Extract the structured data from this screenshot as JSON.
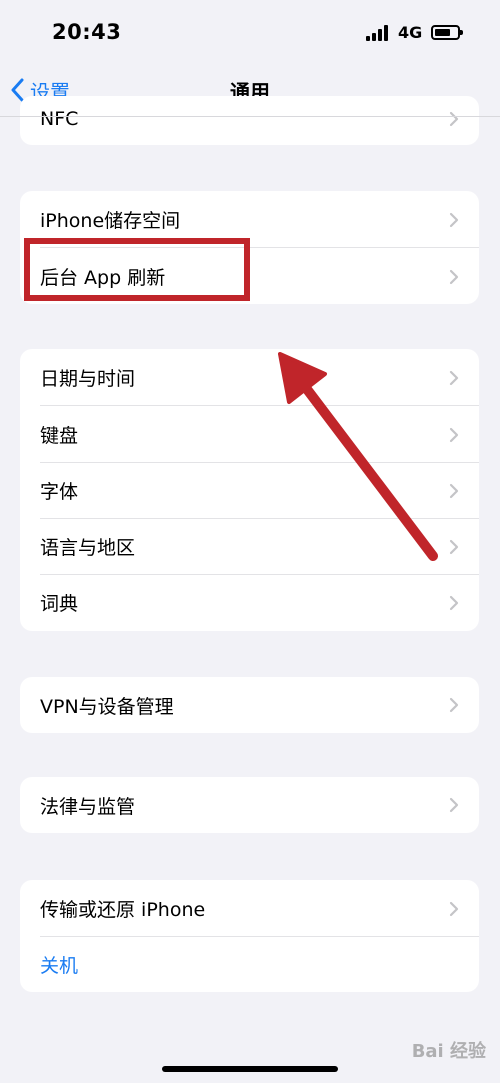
{
  "status_bar": {
    "time": "20:43",
    "network": "4G"
  },
  "navbar": {
    "back_label": "设置",
    "title": "通用"
  },
  "groups": [
    {
      "items": [
        {
          "label": "NFC"
        }
      ]
    },
    {
      "items": [
        {
          "label": "iPhone储存空间"
        },
        {
          "label": "后台 App 刷新"
        }
      ]
    },
    {
      "items": [
        {
          "label": "日期与时间"
        },
        {
          "label": "键盘"
        },
        {
          "label": "字体"
        },
        {
          "label": "语言与地区"
        },
        {
          "label": "词典"
        }
      ]
    },
    {
      "items": [
        {
          "label": "VPN与设备管理"
        }
      ]
    },
    {
      "items": [
        {
          "label": "法律与监管"
        }
      ]
    },
    {
      "items": [
        {
          "label": "传输或还原 iPhone"
        },
        {
          "label": "关机"
        }
      ]
    }
  ],
  "watermark": "Bai 经验",
  "colors": {
    "accent": "#1a7cf2",
    "annotation": "#c0252a",
    "background": "#f2f2f7"
  },
  "icons": {
    "back": "chevron-left-icon",
    "row": "chevron-right-icon"
  }
}
